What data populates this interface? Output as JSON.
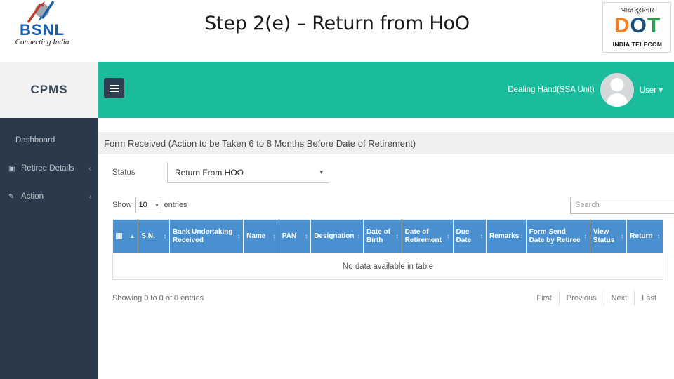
{
  "slide": {
    "title": "Step 2(e) – Return from HoO",
    "bsnl_logo": {
      "word": "BSNL",
      "tagline": "Connecting India"
    },
    "dot_logo": {
      "hindi": "भारत दूरसंचार",
      "letters_d": "D",
      "letters_o": "O",
      "letters_t": "T",
      "caption": "INDIA TELECOM"
    }
  },
  "app": {
    "brand": "CPMS",
    "sidebar": {
      "items": [
        {
          "label": "Dashboard",
          "icon": "",
          "caret": ""
        },
        {
          "label": "Retiree Details",
          "icon": "▣",
          "caret": "‹"
        },
        {
          "label": "Action",
          "icon": "✎",
          "caret": "‹"
        }
      ]
    },
    "topbar": {
      "menu_toggle": "hamburger-icon",
      "role": "Dealing Hand(SSA Unit)",
      "user_menu": "User ▾"
    },
    "panel": {
      "heading": "Form Received (Action to be Taken 6 to 8 Months Before Date of Retirement)",
      "status_label": "Status",
      "status_value": "Return From HOO",
      "status_caret": "▾"
    },
    "table_controls": {
      "show_label": "Show",
      "entries_value": "10",
      "entries_caret": "▾",
      "entries_label": "entries",
      "search_placeholder": "Search"
    },
    "table": {
      "columns": [
        {
          "label": "",
          "type": "checkbox",
          "sort": "▲"
        },
        {
          "label": "S.N.",
          "sort": "↕"
        },
        {
          "label": "Bank Undertaking Received",
          "sort": "↕"
        },
        {
          "label": "Name",
          "sort": "↕"
        },
        {
          "label": "PAN",
          "sort": "↕"
        },
        {
          "label": "Designation",
          "sort": "↕"
        },
        {
          "label": "Date of Birth",
          "sort": "↕"
        },
        {
          "label": "Date of Retirement",
          "sort": "↕"
        },
        {
          "label": "Due Date",
          "sort": "↕"
        },
        {
          "label": "Remarks",
          "sort": "↕"
        },
        {
          "label": "Form Send Date by Retiree",
          "sort": "↕"
        },
        {
          "label": "View Status",
          "sort": "↕"
        },
        {
          "label": "Return",
          "sort": "↕"
        }
      ],
      "rows": [],
      "empty_message": "No data available in table"
    },
    "footer": {
      "showing_info": "Showing 0 to 0 of 0 entries",
      "pagination": [
        "First",
        "Previous",
        "Next",
        "Last"
      ]
    }
  },
  "colors": {
    "teal": "#1abc9c",
    "sidebar": "#2b3a4a",
    "table_header_blue": "#4a90d0",
    "bsnl_blue": "#1b5ea8"
  }
}
